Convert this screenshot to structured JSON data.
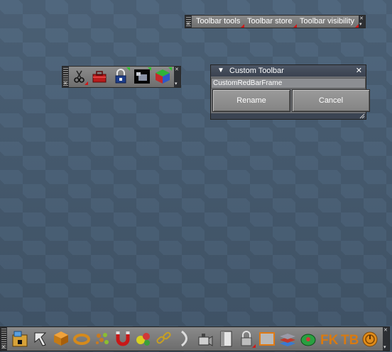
{
  "text_toolbar": {
    "menus": [
      {
        "label": "Toolbar tools"
      },
      {
        "label": "Toolbar store"
      },
      {
        "label": "Toolbar visibility"
      }
    ]
  },
  "icon_toolbar": {
    "buttons": [
      {
        "icon": "scissors-icon"
      },
      {
        "icon": "toolbox-icon"
      },
      {
        "icon": "lock-icon"
      },
      {
        "icon": "render-preview-icon"
      },
      {
        "icon": "color-cube-icon"
      }
    ]
  },
  "dialog": {
    "title": "Custom Toolbar",
    "name_value": "CustomRedBarFrame",
    "rename_label": "Rename",
    "cancel_label": "Cancel"
  },
  "bottom_toolbar": {
    "tools": [
      {
        "icon": "scene-explorer-icon"
      },
      {
        "icon": "select-arrow-icon"
      },
      {
        "icon": "create-box-icon"
      },
      {
        "icon": "ring-icon"
      },
      {
        "icon": "particles-icon"
      },
      {
        "icon": "magnet-icon"
      },
      {
        "icon": "spheres-icon"
      },
      {
        "icon": "link-icon"
      },
      {
        "icon": "arc-icon"
      },
      {
        "icon": "camera-icon"
      },
      {
        "icon": "door-icon"
      },
      {
        "icon": "lock-icon"
      },
      {
        "icon": "frame-icon"
      },
      {
        "icon": "layers-icon"
      },
      {
        "icon": "green-disc-icon"
      },
      {
        "icon": "fk-icon"
      },
      {
        "icon": "tb-icon"
      },
      {
        "icon": "timer-icon"
      }
    ],
    "fk_label": "FK",
    "tb_label": "TB"
  }
}
